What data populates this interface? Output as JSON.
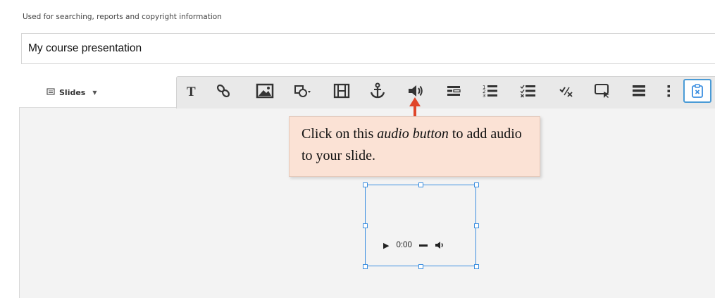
{
  "form": {
    "hint": "Used for searching, reports and copyright information",
    "title_value": "My course presentation"
  },
  "slides_menu": {
    "label": "Slides"
  },
  "toolbar": {
    "buttons": [
      "text-icon",
      "link-icon",
      "image-icon",
      "shapes-icon",
      "video-icon",
      "anchor-icon",
      "audio-icon",
      "fill-in-blanks-icon",
      "single-choice-icon",
      "multiple-choice-icon",
      "true-false-icon",
      "drag-text-icon",
      "table-icon",
      "more-icon",
      "paste-icon"
    ],
    "active": "paste-icon"
  },
  "callout": {
    "text_before": "Click on this ",
    "text_emphasis": "audio button",
    "text_after": " to add audio to your slide."
  },
  "audio_player": {
    "time": "0:00"
  },
  "colors": {
    "accent": "#3a8ee0",
    "arrow": "#e0462a",
    "callout_bg": "#fbe2d5"
  }
}
